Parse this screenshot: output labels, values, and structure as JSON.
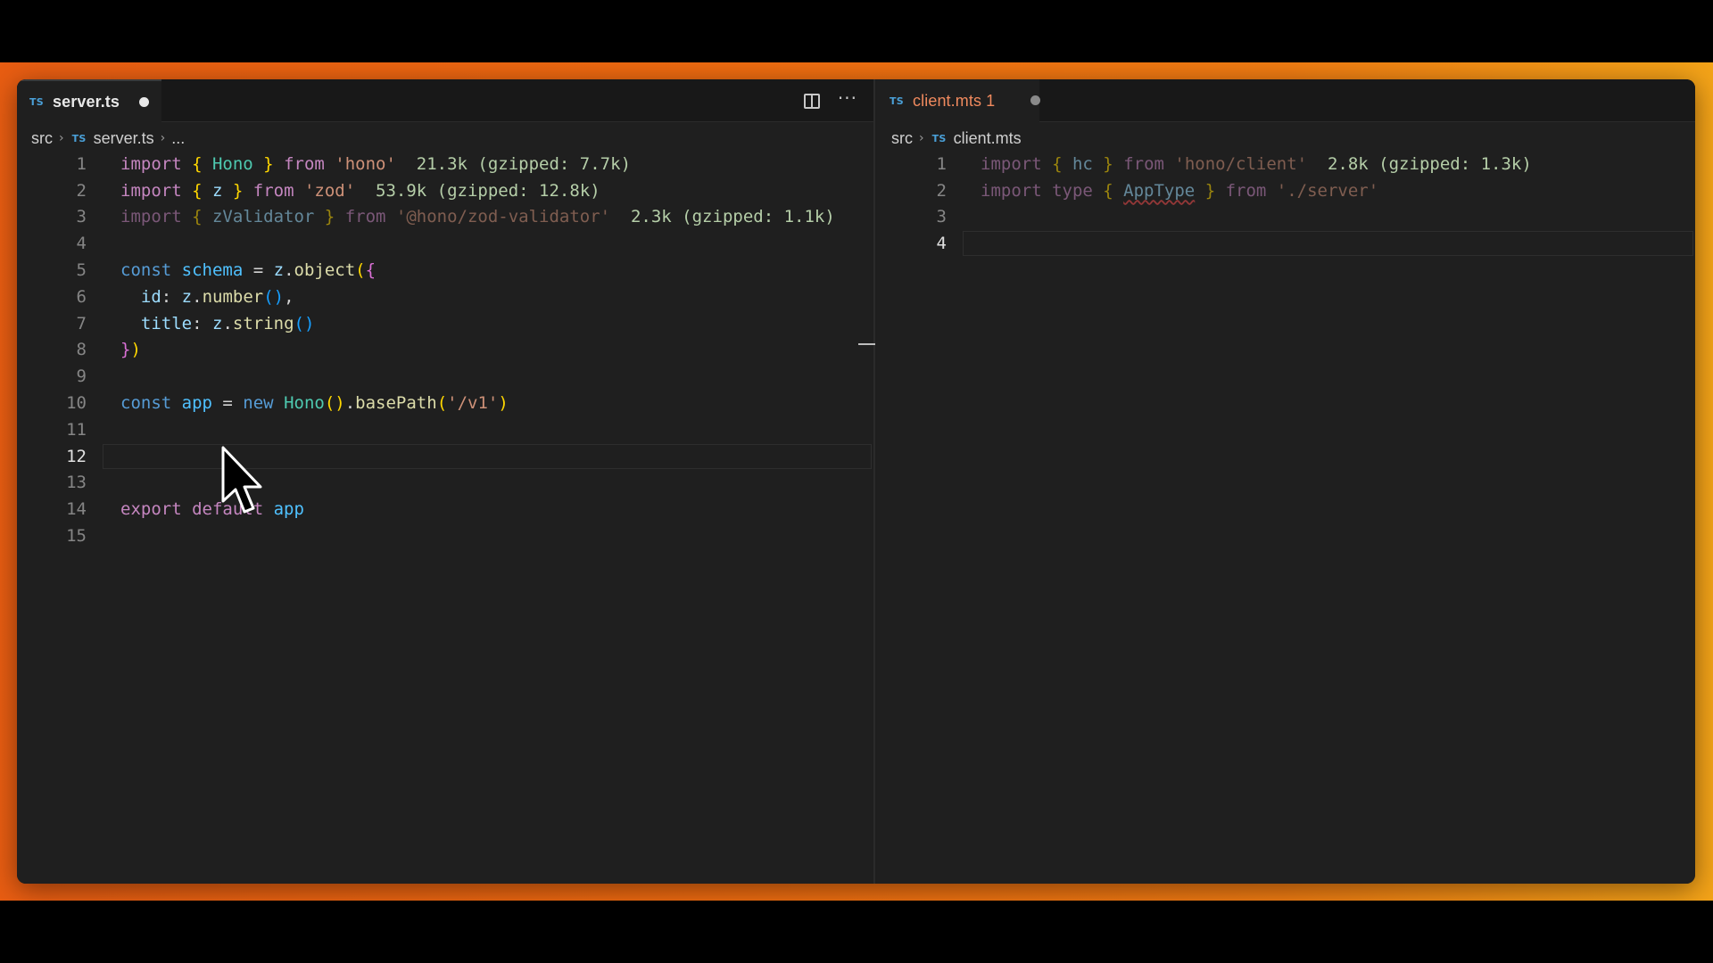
{
  "left": {
    "tab": {
      "badge": "TS",
      "label": "server.ts"
    },
    "breadcrumb": {
      "folder": "src",
      "badge": "TS",
      "file": "server.ts",
      "more": "..."
    },
    "lines": [
      {
        "n": "1",
        "tokens": [
          [
            "kw",
            "import "
          ],
          [
            "br1",
            "{ "
          ],
          [
            "cls",
            "Hono"
          ],
          [
            "br1",
            " }"
          ],
          [
            "kw",
            " from "
          ],
          [
            "str",
            "'hono'"
          ],
          [
            "hint",
            "  21.3k (gzipped: 7.7k)"
          ]
        ]
      },
      {
        "n": "2",
        "tokens": [
          [
            "kw",
            "import "
          ],
          [
            "br1",
            "{ "
          ],
          [
            "id",
            "z"
          ],
          [
            "br1",
            " }"
          ],
          [
            "kw",
            " from "
          ],
          [
            "str",
            "'zod'"
          ],
          [
            "hint",
            "  53.9k (gzipped: 12.8k)"
          ]
        ]
      },
      {
        "n": "3",
        "dim": true,
        "tokens": [
          [
            "kw",
            "import "
          ],
          [
            "br1",
            "{ "
          ],
          [
            "id",
            "zValidator"
          ],
          [
            "br1",
            " }"
          ],
          [
            "kw",
            " from "
          ],
          [
            "str",
            "'@hono/zod-validator'"
          ],
          [
            "hint",
            "  2.3k (gzipped: 1.1k)"
          ]
        ]
      },
      {
        "n": "4",
        "tokens": []
      },
      {
        "n": "5",
        "tokens": [
          [
            "kw2",
            "const "
          ],
          [
            "var",
            "schema"
          ],
          [
            "plain",
            " = "
          ],
          [
            "id",
            "z"
          ],
          [
            "plain",
            "."
          ],
          [
            "fn",
            "object"
          ],
          [
            "br1",
            "("
          ],
          [
            "br2",
            "{"
          ]
        ]
      },
      {
        "n": "6",
        "tokens": [
          [
            "plain",
            "  "
          ],
          [
            "id",
            "id"
          ],
          [
            "plain",
            ": "
          ],
          [
            "id",
            "z"
          ],
          [
            "plain",
            "."
          ],
          [
            "fn",
            "number"
          ],
          [
            "br3",
            "()"
          ],
          [
            "plain",
            ","
          ]
        ]
      },
      {
        "n": "7",
        "tokens": [
          [
            "plain",
            "  "
          ],
          [
            "id",
            "title"
          ],
          [
            "plain",
            ": "
          ],
          [
            "id",
            "z"
          ],
          [
            "plain",
            "."
          ],
          [
            "fn",
            "string"
          ],
          [
            "br3",
            "()"
          ]
        ]
      },
      {
        "n": "8",
        "tokens": [
          [
            "br2",
            "}"
          ],
          [
            "br1",
            ")"
          ]
        ]
      },
      {
        "n": "9",
        "tokens": []
      },
      {
        "n": "10",
        "tokens": [
          [
            "kw2",
            "const "
          ],
          [
            "var",
            "app"
          ],
          [
            "plain",
            " = "
          ],
          [
            "kw2",
            "new "
          ],
          [
            "cls",
            "Hono"
          ],
          [
            "br1",
            "()"
          ],
          [
            "plain",
            "."
          ],
          [
            "fn",
            "basePath"
          ],
          [
            "br1",
            "("
          ],
          [
            "str",
            "'/v1'"
          ],
          [
            "br1",
            ")"
          ]
        ]
      },
      {
        "n": "11",
        "tokens": []
      },
      {
        "n": "12",
        "active": true,
        "tokens": []
      },
      {
        "n": "13",
        "tokens": []
      },
      {
        "n": "14",
        "tokens": [
          [
            "kw",
            "export "
          ],
          [
            "kw",
            "default "
          ],
          [
            "var",
            "app"
          ]
        ]
      },
      {
        "n": "15",
        "tokens": []
      }
    ]
  },
  "right": {
    "tab": {
      "badge": "TS",
      "label": "client.mts 1"
    },
    "breadcrumb": {
      "folder": "src",
      "badge": "TS",
      "file": "client.mts"
    },
    "lines": [
      {
        "n": "1",
        "dim": true,
        "tokens": [
          [
            "kw",
            "import "
          ],
          [
            "br1",
            "{ "
          ],
          [
            "id",
            "hc"
          ],
          [
            "br1",
            " }"
          ],
          [
            "kw",
            " from "
          ],
          [
            "str",
            "'hono/client'"
          ],
          [
            "hint",
            "  2.8k (gzipped: 1.3k)"
          ]
        ]
      },
      {
        "n": "2",
        "dim": true,
        "tokens": [
          [
            "kw",
            "import "
          ],
          [
            "kw",
            "type "
          ],
          [
            "br1",
            "{ "
          ],
          [
            "id squiggle",
            "AppType"
          ],
          [
            "br1",
            " }"
          ],
          [
            "kw",
            " from "
          ],
          [
            "str",
            "'./server'"
          ]
        ]
      },
      {
        "n": "3",
        "tokens": []
      },
      {
        "n": "4",
        "active": true,
        "tokens": []
      }
    ]
  },
  "colors": {
    "accent": "#e85d12",
    "editor_bg": "#1f1f1f"
  },
  "icons": [
    "split-editor-icon",
    "more-actions-icon",
    "mouse-pointer-icon"
  ]
}
